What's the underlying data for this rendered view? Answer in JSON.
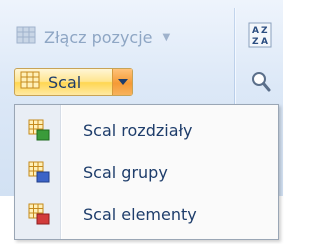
{
  "ribbon": {
    "zlacz": {
      "label": "Złącz pozycje",
      "icon": "merge-items-icon",
      "enabled": false
    },
    "scal": {
      "label": "Scal",
      "icon": "merge-table-icon"
    },
    "right_group": {
      "icons": [
        "sort-az-icon",
        "search-icon"
      ]
    }
  },
  "menu": {
    "items": [
      {
        "label": "Scal rozdziały",
        "icon": "merge-chapters-icon",
        "accent": "#3a9b3a"
      },
      {
        "label": "Scal grupy",
        "icon": "merge-groups-icon",
        "accent": "#3c63c7"
      },
      {
        "label": "Scal elementy",
        "icon": "merge-elements-icon",
        "accent": "#d23b3b"
      }
    ]
  },
  "colors": {
    "text": "#1e3d6b",
    "disabled_text": "#8ea6c4",
    "button_highlight": "#ffd651",
    "dropdown_arrow": "#f59a35"
  }
}
